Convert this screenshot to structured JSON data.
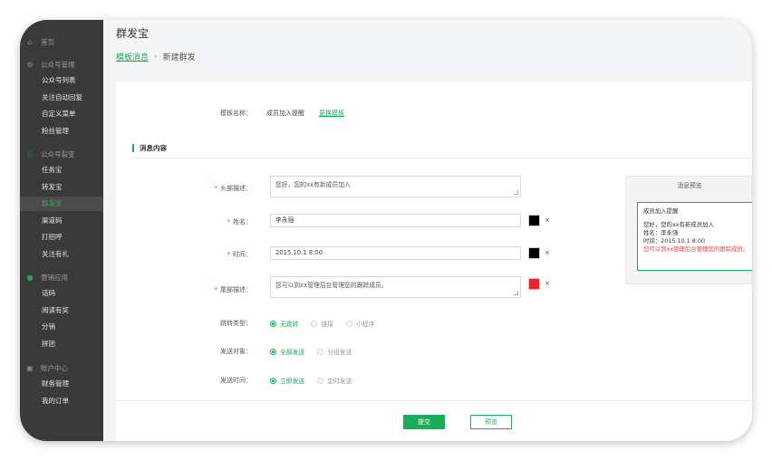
{
  "sidebar": {
    "home": {
      "icon": "home-icon",
      "label": "首页"
    },
    "groups": [
      {
        "icon": "gear-icon",
        "label": "公众号管理",
        "items": [
          "公众号列表",
          "关注自动回复",
          "自定义菜单",
          "粉丝管理"
        ]
      },
      {
        "icon": "wechat-icon",
        "label": "公众号裂变",
        "items": [
          "任务宝",
          "转发宝",
          "群发宝",
          "渠道码",
          "打招呼",
          "关注有礼"
        ]
      },
      {
        "icon": "chat-icon",
        "label": "营销应用",
        "items": [
          "话码",
          "阅读有奖",
          "分销",
          "拼团"
        ]
      },
      {
        "icon": "user-icon",
        "label": "账户中心",
        "items": [
          "财务管理",
          "我的订单"
        ]
      }
    ],
    "active": "群发宝"
  },
  "header": {
    "title": "群发宝"
  },
  "breadcrumb": {
    "parent": "模板消息",
    "separator": "›",
    "current": "新建群发"
  },
  "form": {
    "template_name_label": "模板名称：",
    "template_name_value": "成员加入提醒",
    "change_template_link": "更换模板",
    "section_title": "消息内容",
    "header_desc": {
      "label": "头部描述：",
      "value": "您好，您的xx有新成员加入",
      "color": "#000000"
    },
    "name": {
      "label": "姓名：",
      "value": "李永强",
      "color": "#000000"
    },
    "time": {
      "label": "时间：",
      "value": "2015.10.1 8:00",
      "color": "#000000"
    },
    "footer_desc": {
      "label": "尾部描述：",
      "value": "您可以到xx管理后台管理您的跟踪成员。",
      "color": "#e8232b"
    },
    "clear_symbol": "×",
    "jump_type": {
      "label": "跳转类型：",
      "options": [
        "无跳转",
        "链接",
        "小程序"
      ],
      "selected": 0
    },
    "send_target": {
      "label": "发送对象：",
      "options": [
        "全部发送",
        "分组发送"
      ],
      "selected": 0
    },
    "send_time": {
      "label": "发送时间：",
      "options": [
        "立即发送",
        "定时发送"
      ],
      "selected": 0
    },
    "submit_label": "提交",
    "preview_label": "预览"
  },
  "preview": {
    "title": "消息预览",
    "card_title": "成员加入提醒",
    "header_line": "您好，您的xx有新成员加入",
    "name_line": "姓名：李永强",
    "time_line": "时间：2015.10.1 8:00",
    "footer_line": "您可以到xx管理后台管理您的跟踪成员。"
  },
  "colors": {
    "accent": "#1aad57",
    "sidebar_bg": "#3a3a3a",
    "required": "#e64340"
  }
}
